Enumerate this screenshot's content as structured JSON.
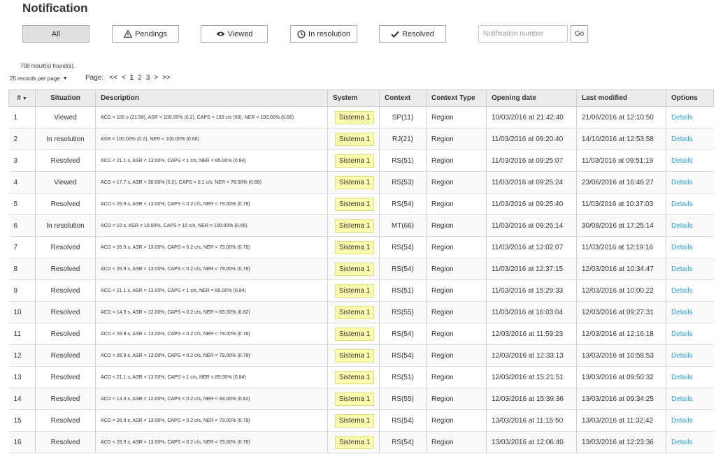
{
  "page": {
    "title": "Notification"
  },
  "filters": [
    {
      "label": "All",
      "icon": "",
      "active": true
    },
    {
      "label": "Pendings",
      "icon": "warning-icon",
      "active": false
    },
    {
      "label": "Viewed",
      "icon": "eye-icon",
      "active": false
    },
    {
      "label": "In resolution",
      "icon": "clock-icon",
      "active": false
    },
    {
      "label": "Resolved",
      "icon": "check-icon",
      "active": false
    }
  ],
  "search": {
    "placeholder": "Notification number",
    "value": "",
    "go_label": "Go"
  },
  "results": {
    "count_text": "708 result(s) found(s)."
  },
  "records_per_page": {
    "label": "25 records per page"
  },
  "pager": {
    "label": "Page:",
    "items": [
      {
        "text": "<<",
        "current": false
      },
      {
        "text": "<",
        "current": false
      },
      {
        "text": "1",
        "current": true
      },
      {
        "text": "2",
        "current": false
      },
      {
        "text": "3",
        "current": false
      },
      {
        "text": ">",
        "current": false
      },
      {
        "text": ">>",
        "current": false
      }
    ]
  },
  "table": {
    "columns": [
      "#",
      "Situation",
      "Description",
      "System",
      "Context",
      "Context Type",
      "Opening date",
      "Last modified",
      "Options"
    ],
    "rows": [
      {
        "n": "1",
        "situation": "Viewed",
        "description": "ACD < 100 s (21.58), ASR < 100.00% (0.2), CAPS < 100 c/s (50), NER < 100.00% (0.66)",
        "system": "Sistema 1",
        "context": "SP(11)",
        "context_type": "Region",
        "opening": "10/03/2016 at 21:42:40",
        "modified": "21/06/2016 at 12:10:50",
        "option": "Details"
      },
      {
        "n": "2",
        "situation": "In resolution",
        "description": "ASR < 100.00% (0.2), NER < 100.00% (0.66)",
        "system": "Sistema 1",
        "context": "RJ(21)",
        "context_type": "Region",
        "opening": "11/03/2016 at 09:20:40",
        "modified": "14/10/2016 at 12:53:58",
        "option": "Details"
      },
      {
        "n": "3",
        "situation": "Resolved",
        "description": "ACD < 21.1 s, ASR < 13.00%, CAPS < 1 c/s, NER < 85.00% (0.84)",
        "system": "Sistema 1",
        "context": "RS(51)",
        "context_type": "Region",
        "opening": "11/03/2016 at 09:25:07",
        "modified": "11/03/2016 at 09:51:19",
        "option": "Details"
      },
      {
        "n": "4",
        "situation": "Viewed",
        "description": "ACD < 17.7 s, ASR < 30.00% (0.2), CAPS < 0.1 c/s, NER < 78.00% (0.66)",
        "system": "Sistema 1",
        "context": "RS(53)",
        "context_type": "Region",
        "opening": "11/03/2016 at 09:25:24",
        "modified": "23/06/2016 at 16:46:27",
        "option": "Details"
      },
      {
        "n": "5",
        "situation": "Resolved",
        "description": "ACD < 26.9 s, ASR < 13.00%, CAPS < 0.2 c/s, NER < 79.00% (0.78)",
        "system": "Sistema 1",
        "context": "RS(54)",
        "context_type": "Region",
        "opening": "11/03/2016 at 09:25:40",
        "modified": "11/03/2016 at 10:37:03",
        "option": "Details"
      },
      {
        "n": "6",
        "situation": "In resolution",
        "description": "ACD < 10 s, ASR < 10.00%, CAPS < 10 c/s, NER < 100.00% (0.66)",
        "system": "Sistema 1",
        "context": "MT(66)",
        "context_type": "Region",
        "opening": "11/03/2016 at 09:26:14",
        "modified": "30/08/2016 at 17:25:14",
        "option": "Details"
      },
      {
        "n": "7",
        "situation": "Resolved",
        "description": "ACD < 26.9 s, ASR < 13.00%, CAPS < 0.2 c/s, NER < 79.00% (0.78)",
        "system": "Sistema 1",
        "context": "RS(54)",
        "context_type": "Region",
        "opening": "11/03/2016 at 12:02:07",
        "modified": "11/03/2016 at 12:19:16",
        "option": "Details"
      },
      {
        "n": "8",
        "situation": "Resolved",
        "description": "ACD < 26.9 s, ASR < 13.00%, CAPS < 0.2 c/s, NER < 79.00% (0.78)",
        "system": "Sistema 1",
        "context": "RS(54)",
        "context_type": "Region",
        "opening": "11/03/2016 at 12:37:15",
        "modified": "12/03/2016 at 10:34:47",
        "option": "Details"
      },
      {
        "n": "9",
        "situation": "Resolved",
        "description": "ACD < 21.1 s, ASR < 13.00%, CAPS < 1 c/s, NER < 85.00% (0.84)",
        "system": "Sistema 1",
        "context": "RS(51)",
        "context_type": "Region",
        "opening": "11/03/2016 at 15:29:33",
        "modified": "12/03/2016 at 10:00:22",
        "option": "Details"
      },
      {
        "n": "10",
        "situation": "Resolved",
        "description": "ACD < 14.3 s, ASR < 12.00%, CAPS < 0.2 c/s, NER < 83.00% (0.82)",
        "system": "Sistema 1",
        "context": "RS(55)",
        "context_type": "Region",
        "opening": "11/03/2016 at 16:03:04",
        "modified": "12/03/2016 at 09:27:31",
        "option": "Details"
      },
      {
        "n": "11",
        "situation": "Resolved",
        "description": "ACD < 26.9 s, ASR < 13.00%, CAPS < 0.2 c/s, NER < 79.00% (0.78)",
        "system": "Sistema 1",
        "context": "RS(54)",
        "context_type": "Region",
        "opening": "12/03/2016 at 11:59:23",
        "modified": "12/03/2016 at 12:16:18",
        "option": "Details"
      },
      {
        "n": "12",
        "situation": "Resolved",
        "description": "ACD < 26.9 s, ASR < 13.00%, CAPS < 0.2 c/s, NER < 79.00% (0.78)",
        "system": "Sistema 1",
        "context": "RS(54)",
        "context_type": "Region",
        "opening": "12/03/2016 at 12:33:13",
        "modified": "13/03/2016 at 10:58:53",
        "option": "Details"
      },
      {
        "n": "13",
        "situation": "Resolved",
        "description": "ACD < 21.1 s, ASR < 13.00%, CAPS < 1 c/s, NER < 85.00% (0.84)",
        "system": "Sistema 1",
        "context": "RS(51)",
        "context_type": "Region",
        "opening": "12/03/2016 at 15:21:51",
        "modified": "13/03/2016 at 09:50:32",
        "option": "Details"
      },
      {
        "n": "14",
        "situation": "Resolved",
        "description": "ACD < 14.3 s, ASR < 12.00%, CAPS < 0.2 c/s, NER < 83.00% (0.82)",
        "system": "Sistema 1",
        "context": "RS(55)",
        "context_type": "Region",
        "opening": "12/03/2016 at 15:39:36",
        "modified": "13/03/2016 at 09:34:25",
        "option": "Details"
      },
      {
        "n": "15",
        "situation": "Resolved",
        "description": "ACD < 26.9 s, ASR < 13.00%, CAPS < 0.2 c/s, NER < 79.00% (0.78)",
        "system": "Sistema 1",
        "context": "RS(54)",
        "context_type": "Region",
        "opening": "13/03/2016 at 11:15:50",
        "modified": "13/03/2016 at 11:32:42",
        "option": "Details"
      },
      {
        "n": "16",
        "situation": "Resolved",
        "description": "ACD < 26.9 s, ASR < 13.00%, CAPS < 0.2 c/s, NER < 79.00% (0.78)",
        "system": "Sistema 1",
        "context": "RS(54)",
        "context_type": "Region",
        "opening": "13/03/2016 at 12:06:40",
        "modified": "13/03/2016 at 12:23:36",
        "option": "Details"
      }
    ]
  },
  "colors": {
    "link": "#2a9fd6",
    "badge_bg": "#fefeae",
    "header_bg": "#ececec"
  }
}
